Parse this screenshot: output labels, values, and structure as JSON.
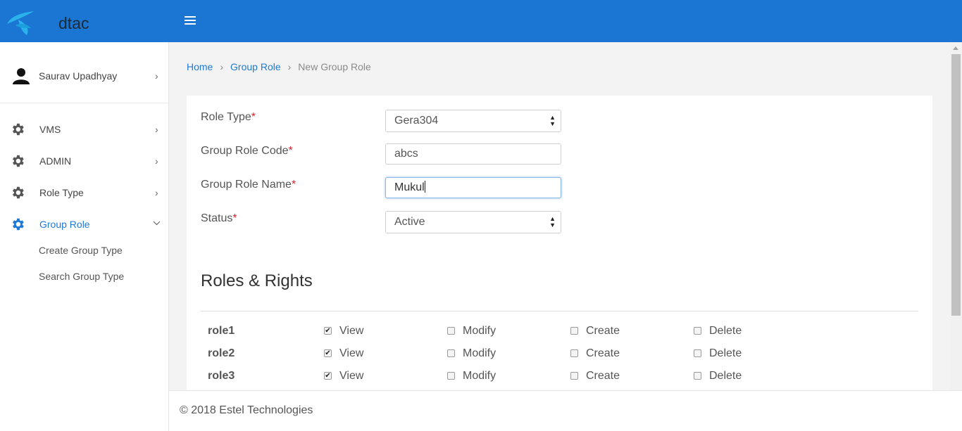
{
  "header": {
    "brand": "dtac",
    "logo_icon": "dtac-logo-icon",
    "menu_icon": "hamburger-icon",
    "color": "#1a76d2"
  },
  "sidebar": {
    "user": {
      "name": "Saurav Upadhyay",
      "icon": "user-icon"
    },
    "items": [
      {
        "label": "VMS",
        "icon": "gear-icon",
        "active": false
      },
      {
        "label": "ADMIN",
        "icon": "gear-icon",
        "active": false
      },
      {
        "label": "Role Type",
        "icon": "gear-icon",
        "active": false
      },
      {
        "label": "Group Role",
        "icon": "gear-icon",
        "active": true,
        "children": [
          {
            "label": "Create Group Type"
          },
          {
            "label": "Search Group Type"
          }
        ]
      }
    ],
    "active_color": "#1f7ad6"
  },
  "breadcrumb": {
    "home": "Home",
    "group_role": "Group Role",
    "current": "New Group Role"
  },
  "form": {
    "role_type": {
      "label": "Role Type",
      "required": "*",
      "value": "Gera304"
    },
    "group_role_code": {
      "label": "Group Role Code",
      "required": "*",
      "value": "abcs"
    },
    "group_role_name": {
      "label": "Group Role Name",
      "required": "*",
      "value": "Mukul"
    },
    "status": {
      "label": "Status",
      "required": "*",
      "value": "Active"
    }
  },
  "roles_rights": {
    "title": "Roles & Rights",
    "permission_labels": [
      "View",
      "Modify",
      "Create",
      "Delete"
    ],
    "rows": [
      {
        "name": "role1",
        "view": true,
        "modify": false,
        "create": false,
        "delete": false
      },
      {
        "name": "role2",
        "view": true,
        "modify": false,
        "create": false,
        "delete": false
      },
      {
        "name": "role3",
        "view": true,
        "modify": false,
        "create": false,
        "delete": false
      }
    ]
  },
  "footer": {
    "text": "© 2018 Estel Technologies"
  }
}
